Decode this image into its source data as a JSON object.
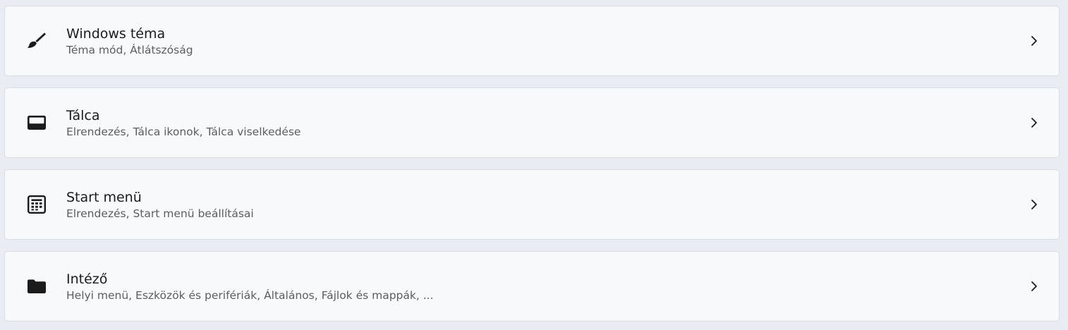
{
  "items": [
    {
      "title": "Windows téma",
      "subtitle": "Téma mód, Átlátszóság",
      "icon": "paintbrush-icon"
    },
    {
      "title": "Tálca",
      "subtitle": "Elrendezés, Tálca ikonok, Tálca viselkedése",
      "icon": "taskbar-icon"
    },
    {
      "title": "Start menü",
      "subtitle": "Elrendezés, Start menü beállításai",
      "icon": "start-menu-icon"
    },
    {
      "title": "Intéző",
      "subtitle": "Helyi menü, Eszközök és perifériák, Általános, Fájlok és mappák, ...",
      "icon": "folder-icon"
    }
  ],
  "colors": {
    "background": "#e9ecf2",
    "card": "#f8f9fb",
    "title": "#1b1b1b",
    "subtitle": "#5d5d5d"
  }
}
